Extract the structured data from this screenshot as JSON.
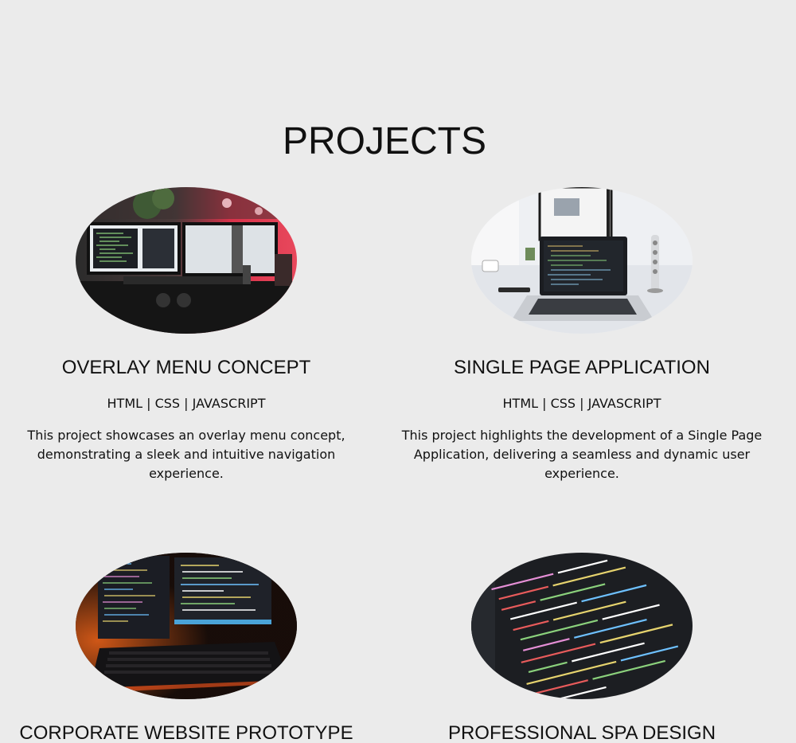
{
  "section": {
    "title": "PROJECTS"
  },
  "projects": [
    {
      "title": "OVERLAY MENU CONCEPT",
      "tags": "HTML | CSS | JAVASCRIPT",
      "description": "This project showcases an overlay menu concept, demonstrating a sleek and intuitive navigation experience.",
      "image_icon": "dual-monitor-desk-image"
    },
    {
      "title": "SINGLE PAGE APPLICATION",
      "tags": "HTML | CSS | JAVASCRIPT",
      "description": "This project highlights the development of a Single Page Application, delivering a seamless and dynamic user experience.",
      "image_icon": "laptop-desk-image"
    },
    {
      "title": "CORPORATE WEBSITE PROTOTYPE",
      "image_icon": "keyboard-monitors-image"
    },
    {
      "title": "PROFESSIONAL SPA DESIGN",
      "image_icon": "code-screen-image"
    }
  ],
  "colors": {
    "background": "#ebebeb",
    "text": "#111111"
  }
}
